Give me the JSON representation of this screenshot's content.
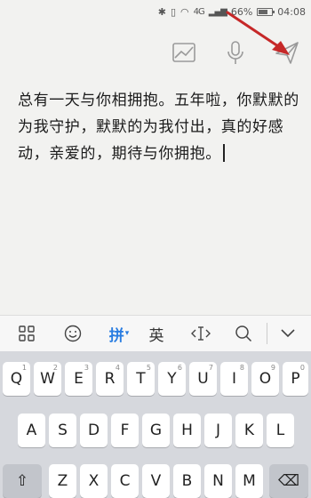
{
  "status_bar": {
    "icons": [
      "bluetooth-icon",
      "vibrate-icon",
      "wifi-icon",
      "signal-icon",
      "battery-icon"
    ],
    "network": "4G",
    "battery": "66%",
    "time": "04:08"
  },
  "toolbar": {
    "icons": [
      "image-icon",
      "microphone-icon",
      "send-icon"
    ]
  },
  "annotation": {
    "color": "#c62828"
  },
  "note": {
    "text": "总有一天与你相拥抱。五年啦，你默默的为我守护，默默的为我付出，真的好感动，亲爱的，期待与你拥抱。"
  },
  "candidate_bar": {
    "items": [
      "grid-icon",
      "emoji-icon",
      "拼",
      "英",
      "cursor-move-icon",
      "search-icon",
      "chevron-down-icon"
    ],
    "pinyin_label": "拼",
    "english_label": "英"
  },
  "keyboard": {
    "row1": [
      {
        "key": "Q",
        "sub": "1"
      },
      {
        "key": "W",
        "sub": "2"
      },
      {
        "key": "E",
        "sub": "3"
      },
      {
        "key": "R",
        "sub": "4"
      },
      {
        "key": "T",
        "sub": "5"
      },
      {
        "key": "Y",
        "sub": "6"
      },
      {
        "key": "U",
        "sub": "7"
      },
      {
        "key": "I",
        "sub": "8"
      },
      {
        "key": "O",
        "sub": "9"
      },
      {
        "key": "P",
        "sub": "0"
      }
    ],
    "row2": [
      "A",
      "S",
      "D",
      "F",
      "G",
      "H",
      "J",
      "K",
      "L"
    ],
    "row3": [
      "Z",
      "X",
      "C",
      "V",
      "B",
      "N",
      "M"
    ],
    "accent": "#2a7de1"
  }
}
